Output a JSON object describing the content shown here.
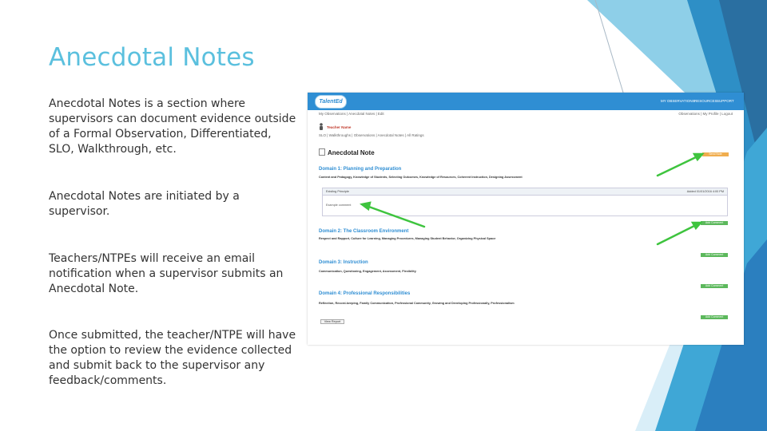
{
  "slide": {
    "title": "Anecdotal Notes",
    "paragraphs": [
      "Anecdotal Notes is a section where supervisors can document evidence outside of a Formal Observation, Differentiated, SLO, Walkthrough, etc.",
      "Anecdotal Notes are initiated by a supervisor.",
      "Teachers/NTPEs will receive an email notification when a supervisor submits an Anecdotal Note.",
      "Once submitted, the teacher/NTPE will have the option to review the evidence collected and submit back to the supervisor any feedback/comments."
    ],
    "colors": {
      "title": "#5bc0de",
      "accent_teal": "#5bc0de",
      "accent_blue": "#2f8ed3",
      "arrow_green": "#3ec43e"
    }
  },
  "screenshot": {
    "logo_text": "TalentEd",
    "top_nav": [
      "MY OBSERVATIONS",
      "RESOURCES",
      "SUPPORT"
    ],
    "breadcrumb": "My Observations | Anecdotal Notes | Edit",
    "user_links": "Observations | My Profile | Logout",
    "teacher_name": "Teacher Name",
    "tabs_row": "SLO | Walkthroughs | Observations | Anecdotal Notes | All Ratings",
    "heading": "Anecdotal Note",
    "orange_button": "Send Note",
    "domains": [
      {
        "title": "Domain 1: Planning and Preparation",
        "components": "Content and Pedagogy, Knowledge of Students, Selecting Outcomes, Knowledge of Resources, Coherent Instruction, Designing Assessment"
      },
      {
        "title": "Domain 2: The Classroom Environment",
        "components": "Respect and Rapport, Culture for Learning, Managing Procedures, Managing Student Behavior, Organizing Physical Space"
      },
      {
        "title": "Domain 3: Instruction",
        "components": "Communication, Questioning, Engagement, Assessment, Flexibility"
      },
      {
        "title": "Domain 4: Professional Responsibilities",
        "components": "Reflection, Record-keeping, Family Communication, Professional Community, Growing and Developing Professionally, Professionalism"
      }
    ],
    "comment_panel": {
      "title": "Existing Principle",
      "date": "Added 01/01/2016  4:00 PM",
      "body": "Example comment"
    },
    "add_buttons": [
      "Add Comment",
      "Add Comment",
      "Add Comment",
      "Add Comment"
    ],
    "view_report": "View Report"
  }
}
